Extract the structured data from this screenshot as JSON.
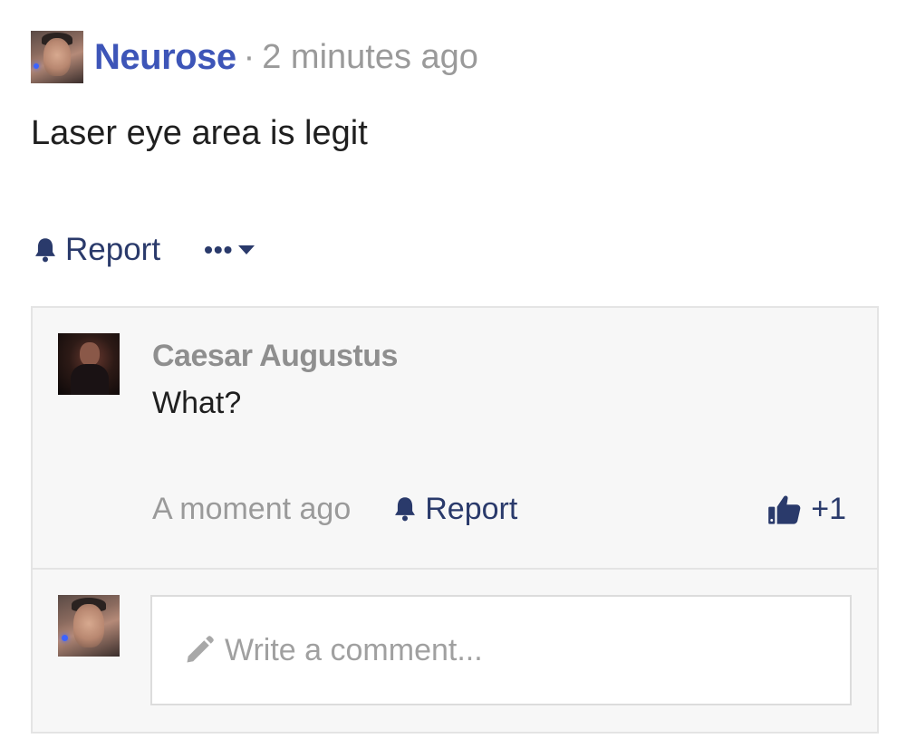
{
  "post": {
    "author": "Neurose",
    "separator": "·",
    "time": "2 minutes ago",
    "body": "Laser eye area is legit",
    "actions": {
      "report_label": "Report",
      "more_label": "•••"
    }
  },
  "reply": {
    "author": "Caesar Augustus",
    "text": "What?",
    "time": "A moment ago",
    "report_label": "Report",
    "like_count": "+1"
  },
  "composer": {
    "placeholder": "Write a comment..."
  },
  "colors": {
    "author_link": "#3d55b8",
    "action_navy": "#2a3a6b",
    "muted_gray": "#9a9a9a",
    "reply_bg": "#f7f7f7"
  },
  "icons": [
    "avatar-neurose",
    "bell-icon",
    "more-dots-icon",
    "caret-down-icon",
    "avatar-caesar",
    "thumbs-up-icon",
    "pencil-icon"
  ]
}
